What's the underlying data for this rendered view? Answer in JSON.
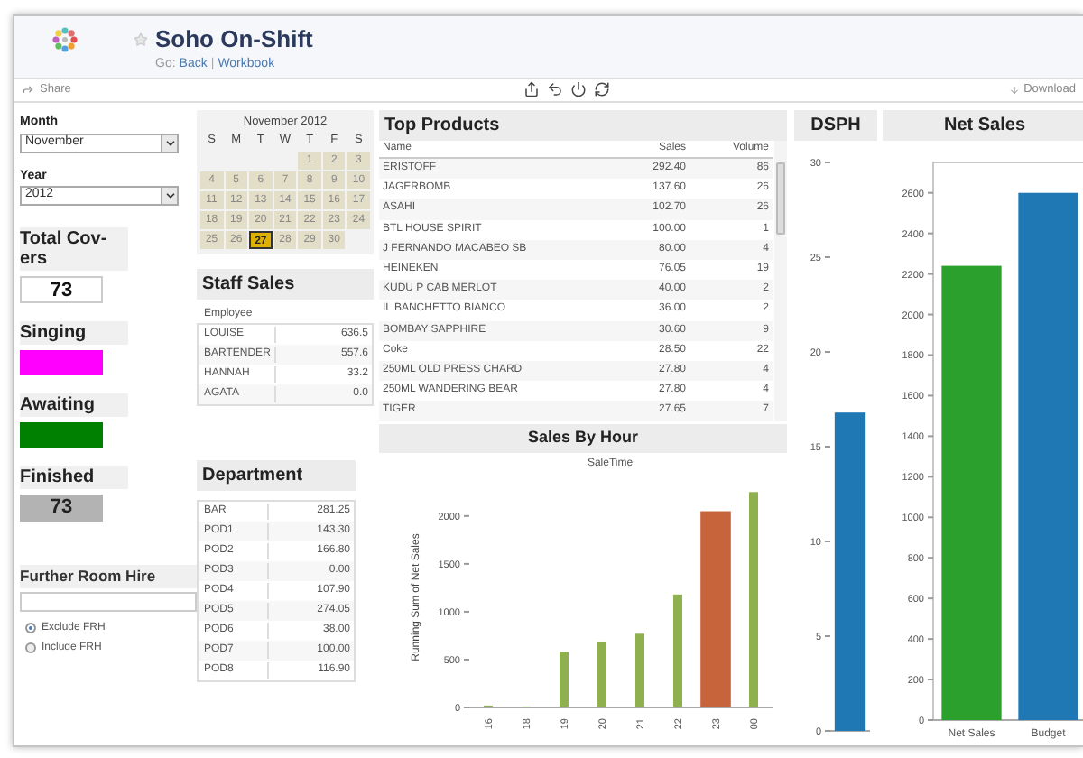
{
  "header": {
    "title": "Soho On-Shift",
    "go_label": "Go:",
    "separator": "|",
    "links": [
      "Back",
      "Workbook"
    ]
  },
  "toolbar": {
    "share": "Share",
    "download": "Download"
  },
  "filters": [
    {
      "label": "Month",
      "value": "November"
    },
    {
      "label": "Year",
      "value": "2012"
    }
  ],
  "tiles": [
    {
      "kind": "value",
      "label": "Total Cov-ers",
      "value": "73"
    },
    {
      "kind": "swatch",
      "label": "Singing",
      "color": "#ff00ff"
    },
    {
      "kind": "swatch",
      "label": "Awaiting",
      "color": "#008000"
    },
    {
      "kind": "shaded",
      "label": "Finished",
      "value": "73"
    }
  ],
  "room_hire": {
    "label": "Further Room Hire",
    "options": [
      {
        "label": "Exclude FRH",
        "selected": true
      },
      {
        "label": "Include FRH",
        "selected": false
      }
    ]
  },
  "calendar": {
    "title": "November 2012",
    "weekdays": [
      "S",
      "M",
      "T",
      "W",
      "T",
      "F",
      "S"
    ],
    "weeks": [
      [
        {
          "label": "1",
          "selected": false
        },
        {
          "label": "2",
          "selected": false
        },
        {
          "label": "3",
          "selected": false
        }
      ],
      [
        {
          "label": "4",
          "selected": false
        },
        {
          "label": "5",
          "selected": false
        },
        {
          "label": "6",
          "selected": false
        },
        {
          "label": "7",
          "selected": false
        },
        {
          "label": "8",
          "selected": false
        },
        {
          "label": "9",
          "selected": false
        },
        {
          "label": "10",
          "selected": false
        }
      ],
      [
        {
          "label": "11",
          "selected": false
        },
        {
          "label": "12",
          "selected": false
        },
        {
          "label": "13",
          "selected": false
        },
        {
          "label": "14",
          "selected": false
        },
        {
          "label": "15",
          "selected": false
        },
        {
          "label": "16",
          "selected": false
        },
        {
          "label": "17",
          "selected": false
        }
      ],
      [
        {
          "label": "18",
          "selected": false
        },
        {
          "label": "19",
          "selected": false
        },
        {
          "label": "20",
          "selected": false
        },
        {
          "label": "21",
          "selected": false
        },
        {
          "label": "22",
          "selected": false
        },
        {
          "label": "23",
          "selected": false
        },
        {
          "label": "24",
          "selected": false
        }
      ],
      [
        {
          "label": "25",
          "selected": false
        },
        {
          "label": "26",
          "selected": false
        },
        {
          "label": "27",
          "selected": true
        },
        {
          "label": "28",
          "selected": false
        },
        {
          "label": "29",
          "selected": false
        },
        {
          "label": "30",
          "selected": false
        }
      ]
    ]
  },
  "staff_sales": {
    "title": "Staff Sales",
    "column": "Employee",
    "rows": [
      [
        "LOUISE",
        "636.5"
      ],
      [
        "BARTENDER",
        "557.6"
      ],
      [
        "HANNAH",
        "33.2"
      ],
      [
        "AGATA",
        "0.0"
      ]
    ]
  },
  "department": {
    "title": "Department",
    "rows": [
      [
        "BAR",
        "281.25"
      ],
      [
        "POD1",
        "143.30"
      ],
      [
        "POD2",
        "166.80"
      ],
      [
        "POD3",
        "0.00"
      ],
      [
        "POD4",
        "107.90"
      ],
      [
        "POD5",
        "274.05"
      ],
      [
        "POD6",
        "38.00"
      ],
      [
        "POD7",
        "100.00"
      ],
      [
        "POD8",
        "116.90"
      ]
    ]
  },
  "top_products": {
    "title": "Top Products",
    "columns": [
      "Name",
      "Sales",
      "Volume"
    ],
    "rows": [
      [
        "ERISTOFF",
        "292.40",
        "86"
      ],
      [
        "JAGERBOMB",
        "137.60",
        "26"
      ],
      [
        "ASAHI",
        "102.70",
        "26"
      ],
      [
        "BTL HOUSE SPIRIT",
        "100.00",
        "1"
      ],
      [
        "J FERNANDO MACABEO SB",
        "80.00",
        "4"
      ],
      [
        "HEINEKEN",
        "76.05",
        "19"
      ],
      [
        "KUDU P CAB MERLOT",
        "40.00",
        "2"
      ],
      [
        "IL BANCHETTO BIANCO",
        "36.00",
        "2"
      ],
      [
        "BOMBAY SAPPHIRE",
        "30.60",
        "9"
      ],
      [
        "Coke",
        "28.50",
        "22"
      ],
      [
        "250ML OLD PRESS CHARD",
        "27.80",
        "4"
      ],
      [
        "250ML WANDERING BEAR",
        "27.80",
        "4"
      ],
      [
        "TIGER",
        "27.65",
        "7"
      ]
    ]
  },
  "sales_by_hour": {
    "chart_data": {
      "type": "bar",
      "title": "Sales By Hour",
      "xlabel": "SaleTime",
      "ylabel": "Running Sum of Net Sales",
      "categories": [
        "16",
        "18",
        "19",
        "20",
        "21",
        "22",
        "23",
        "00"
      ],
      "stacked": true,
      "series": [
        {
          "color": "#8fb04e",
          "values": [
            20,
            10,
            580,
            680,
            770,
            1180,
            null,
            2250
          ]
        },
        {
          "color": "#c8643c",
          "values": [
            null,
            null,
            null,
            null,
            null,
            null,
            2050,
            null
          ]
        }
      ],
      "ylim": [
        0,
        2300
      ],
      "yticks": [
        0,
        500,
        1000,
        1500,
        2000
      ]
    }
  },
  "dsph": {
    "chart_data": {
      "type": "bar",
      "title": "DSPH",
      "categories": [
        null
      ],
      "series": [
        {
          "color": "#1f77b4",
          "values": [
            16.8
          ]
        }
      ],
      "ylim": [
        0,
        30
      ],
      "yticks": [
        0,
        5,
        10,
        15,
        20,
        25,
        30
      ]
    }
  },
  "net_sales": {
    "chart_data": {
      "type": "bar",
      "title": "Net Sales",
      "categories": [
        "Net Sales",
        "Budget"
      ],
      "stacked": true,
      "series": [
        {
          "color": "#2ca02c",
          "values": [
            2240,
            null
          ]
        },
        {
          "color": "#1f77b4",
          "values": [
            null,
            2600
          ]
        }
      ],
      "ylim": [
        0,
        2750
      ],
      "yticks": [
        0,
        200,
        400,
        600,
        800,
        1000,
        1200,
        1400,
        1600,
        1800,
        2000,
        2200,
        2400,
        2600
      ]
    }
  }
}
